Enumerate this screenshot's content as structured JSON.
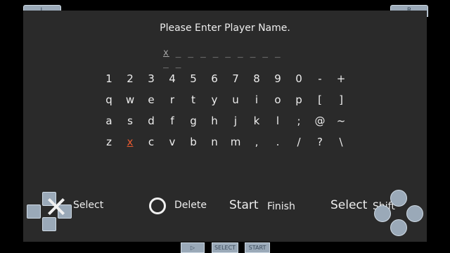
{
  "shoulders": {
    "left": "L",
    "right": "R"
  },
  "title": "Please Enter Player Name.",
  "name_field": {
    "typed": "x",
    "blanks": "_ _ _ _ _ _ _ _ _ _ _"
  },
  "keyboard": {
    "rows": [
      [
        "1",
        "2",
        "3",
        "4",
        "5",
        "6",
        "7",
        "8",
        "9",
        "0",
        "-",
        "+"
      ],
      [
        "q",
        "w",
        "e",
        "r",
        "t",
        "y",
        "u",
        "i",
        "o",
        "p",
        "[",
        "]"
      ],
      [
        "a",
        "s",
        "d",
        "f",
        "g",
        "h",
        "j",
        "k",
        "l",
        ";",
        "@",
        "~"
      ],
      [
        "z",
        "x",
        "c",
        "v",
        "b",
        "n",
        "m",
        ",",
        ".",
        "/",
        "?",
        "\\"
      ]
    ],
    "selected": {
      "row": 3,
      "col": 1
    }
  },
  "controls": {
    "select_label": "Select",
    "delete_label": "Delete",
    "start_word": "Start",
    "finish_label": "Finish",
    "select_word": "Select",
    "shift_label": "Shift"
  },
  "system_bar": {
    "play": "▷",
    "select": "SELECT",
    "start": "START"
  },
  "colors": {
    "selected_key": "#e85a30",
    "button_fill": "#9aa9b8"
  }
}
